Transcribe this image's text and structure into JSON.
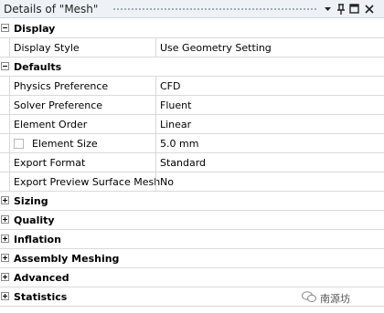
{
  "window": {
    "title": "Details of \"Mesh\"",
    "buttons": [
      "pin-menu",
      "pin",
      "restore",
      "close"
    ]
  },
  "categories": [
    {
      "label": "Display",
      "expanded": true,
      "props": [
        {
          "name": "Display Style",
          "value": "Use Geometry Setting",
          "checkbox": false
        }
      ]
    },
    {
      "label": "Defaults",
      "expanded": true,
      "props": [
        {
          "name": "Physics Preference",
          "value": "CFD",
          "checkbox": false
        },
        {
          "name": "Solver Preference",
          "value": "Fluent",
          "checkbox": false
        },
        {
          "name": "Element Order",
          "value": "Linear",
          "checkbox": false
        },
        {
          "name": "Element Size",
          "value": "5.0 mm",
          "checkbox": true
        },
        {
          "name": "Export Format",
          "value": "Standard",
          "checkbox": false
        },
        {
          "name": "Export Preview Surface Mesh",
          "value": "No",
          "checkbox": false
        }
      ]
    },
    {
      "label": "Sizing",
      "expanded": false,
      "props": []
    },
    {
      "label": "Quality",
      "expanded": false,
      "props": []
    },
    {
      "label": "Inflation",
      "expanded": false,
      "props": []
    },
    {
      "label": "Assembly Meshing",
      "expanded": false,
      "props": []
    },
    {
      "label": "Advanced",
      "expanded": false,
      "props": []
    },
    {
      "label": "Statistics",
      "expanded": false,
      "props": []
    }
  ],
  "watermark": {
    "text": "南源坊"
  }
}
